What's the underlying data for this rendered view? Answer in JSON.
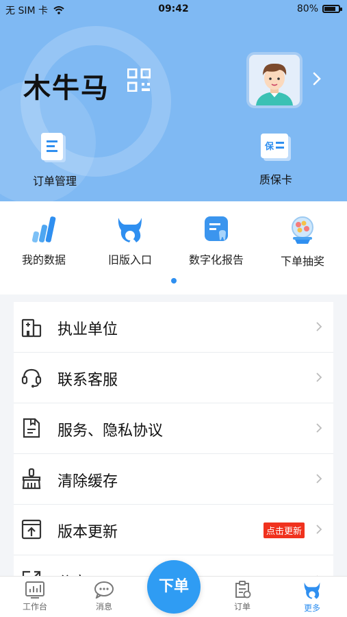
{
  "status_bar": {
    "carrier": "无 SIM 卡",
    "time": "09:42",
    "battery_percent": "80%",
    "battery_level": 0.8
  },
  "profile": {
    "name": "木牛马"
  },
  "quick_actions": [
    {
      "label": "订单管理",
      "icon": "order-doc-icon"
    },
    {
      "label": "质保卡",
      "icon": "warranty-card-icon",
      "icon_text": "保"
    }
  ],
  "feature_menu": [
    {
      "label": "我的数据",
      "icon": "bar-chart-icon"
    },
    {
      "label": "旧版入口",
      "icon": "bull-logo-icon"
    },
    {
      "label": "数字化报告",
      "icon": "tooth-report-icon"
    },
    {
      "label": "下单抽奖",
      "icon": "prize-globe-icon"
    }
  ],
  "settings_list": [
    {
      "label": "执业单位",
      "icon": "building-icon"
    },
    {
      "label": "联系客服",
      "icon": "headset-icon"
    },
    {
      "label": "服务、隐私协议",
      "icon": "agreement-icon"
    },
    {
      "label": "清除缓存",
      "icon": "broom-icon"
    },
    {
      "label": "版本更新",
      "icon": "upload-icon",
      "badge": "点击更新"
    },
    {
      "label": "分享APP",
      "icon": "share-icon"
    }
  ],
  "tab_bar": {
    "tabs": [
      {
        "label": "工作台",
        "icon": "dashboard-icon"
      },
      {
        "label": "消息",
        "icon": "message-icon"
      },
      {
        "label": "订单",
        "icon": "order-icon"
      },
      {
        "label": "更多",
        "icon": "bull-logo-icon"
      }
    ],
    "center_button": "下单",
    "active_tab": "更多"
  },
  "colors": {
    "primary": "#2f8ff0",
    "header_bg": "#7fb9f3",
    "badge": "#f0321e"
  }
}
